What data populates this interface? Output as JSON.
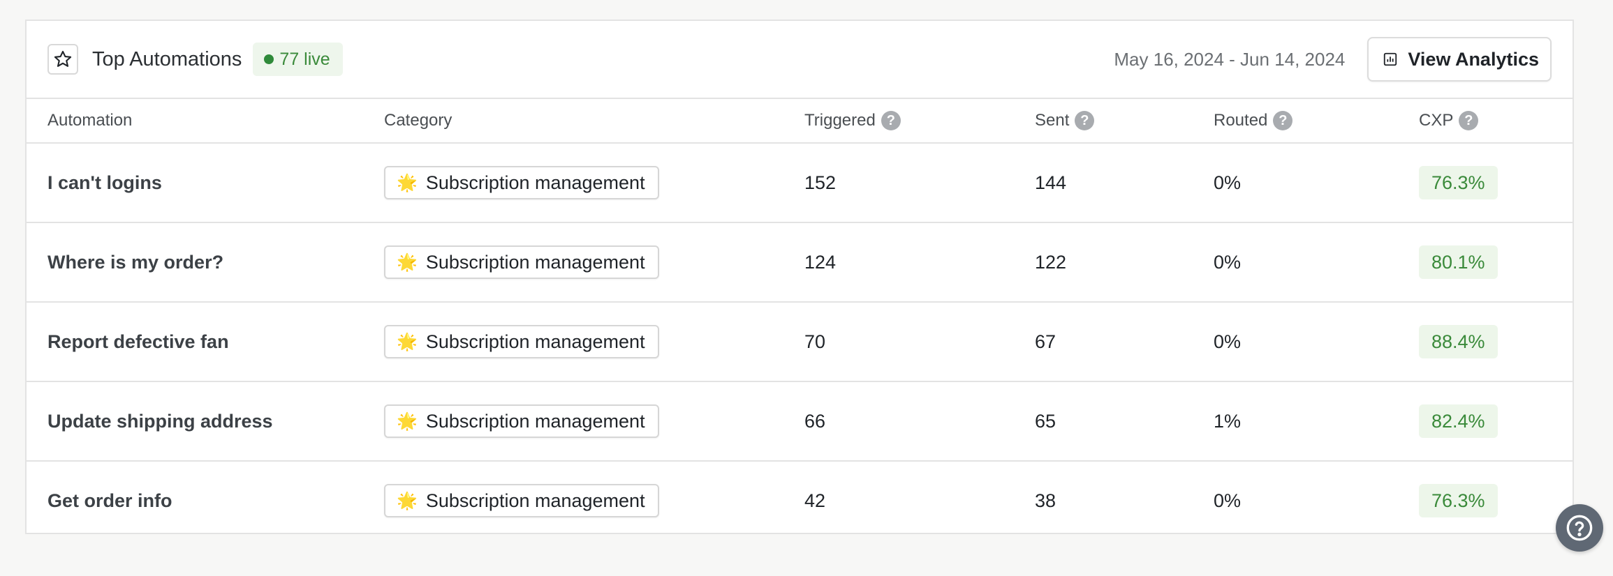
{
  "header": {
    "title": "Top Automations",
    "live_badge": "77 live",
    "date_range": "May 16, 2024 - Jun 14, 2024",
    "view_analytics_label": "View Analytics"
  },
  "columns": {
    "automation": "Automation",
    "category": "Category",
    "triggered": "Triggered",
    "sent": "Sent",
    "routed": "Routed",
    "cxp": "CXP"
  },
  "rows": [
    {
      "automation": "I can't logins",
      "category": "Subscription management",
      "category_emoji": "🌟",
      "triggered": "152",
      "sent": "144",
      "routed": "0%",
      "cxp": "76.3%"
    },
    {
      "automation": "Where is my order?",
      "category": "Subscription management",
      "category_emoji": "🌟",
      "triggered": "124",
      "sent": "122",
      "routed": "0%",
      "cxp": "80.1%"
    },
    {
      "automation": "Report defective fan",
      "category": "Subscription management",
      "category_emoji": "🌟",
      "triggered": "70",
      "sent": "67",
      "routed": "0%",
      "cxp": "88.4%"
    },
    {
      "automation": "Update shipping address",
      "category": "Subscription management",
      "category_emoji": "🌟",
      "triggered": "66",
      "sent": "65",
      "routed": "1%",
      "cxp": "82.4%"
    },
    {
      "automation": "Get order info",
      "category": "Subscription management",
      "category_emoji": "🌟",
      "triggered": "42",
      "sent": "38",
      "routed": "0%",
      "cxp": "76.3%"
    }
  ],
  "icons": {
    "title": "star-icon",
    "analytics": "bar-chart-icon",
    "help": "question-mark-icon"
  },
  "colors": {
    "accent_green": "#3a8a3a",
    "badge_green_bg": "#eef6ec",
    "help_fab": "#5f6874"
  }
}
